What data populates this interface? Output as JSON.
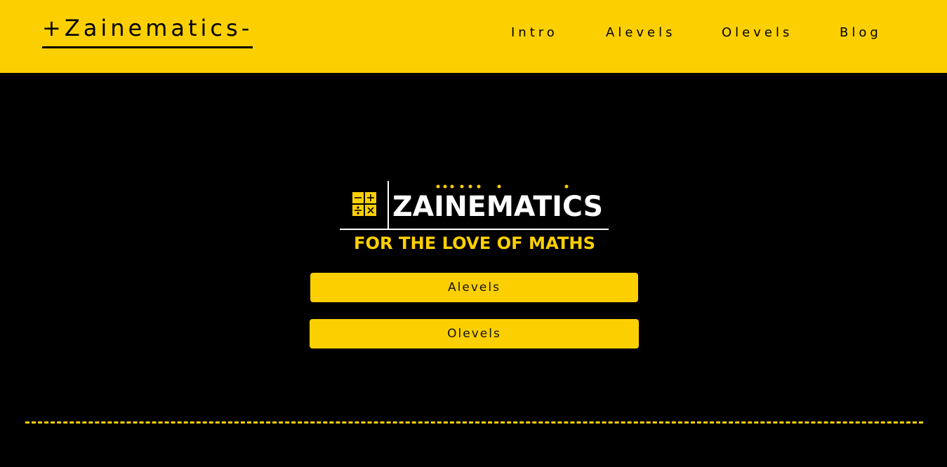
{
  "header": {
    "brand": "+Zainematics-",
    "nav": [
      {
        "label": "Intro"
      },
      {
        "label": "Alevels"
      },
      {
        "label": "Olevels"
      },
      {
        "label": "Blog"
      }
    ]
  },
  "hero": {
    "logo_text": "ZAINEMATICS",
    "logo_tagline": "FOR THE LOVE OF MATHS",
    "buttons": [
      {
        "label": "Alevels"
      },
      {
        "label": "Olevels"
      }
    ]
  },
  "colors": {
    "accent": "#FCD000",
    "background": "#000000",
    "logo_text": "#FFFFFF"
  }
}
